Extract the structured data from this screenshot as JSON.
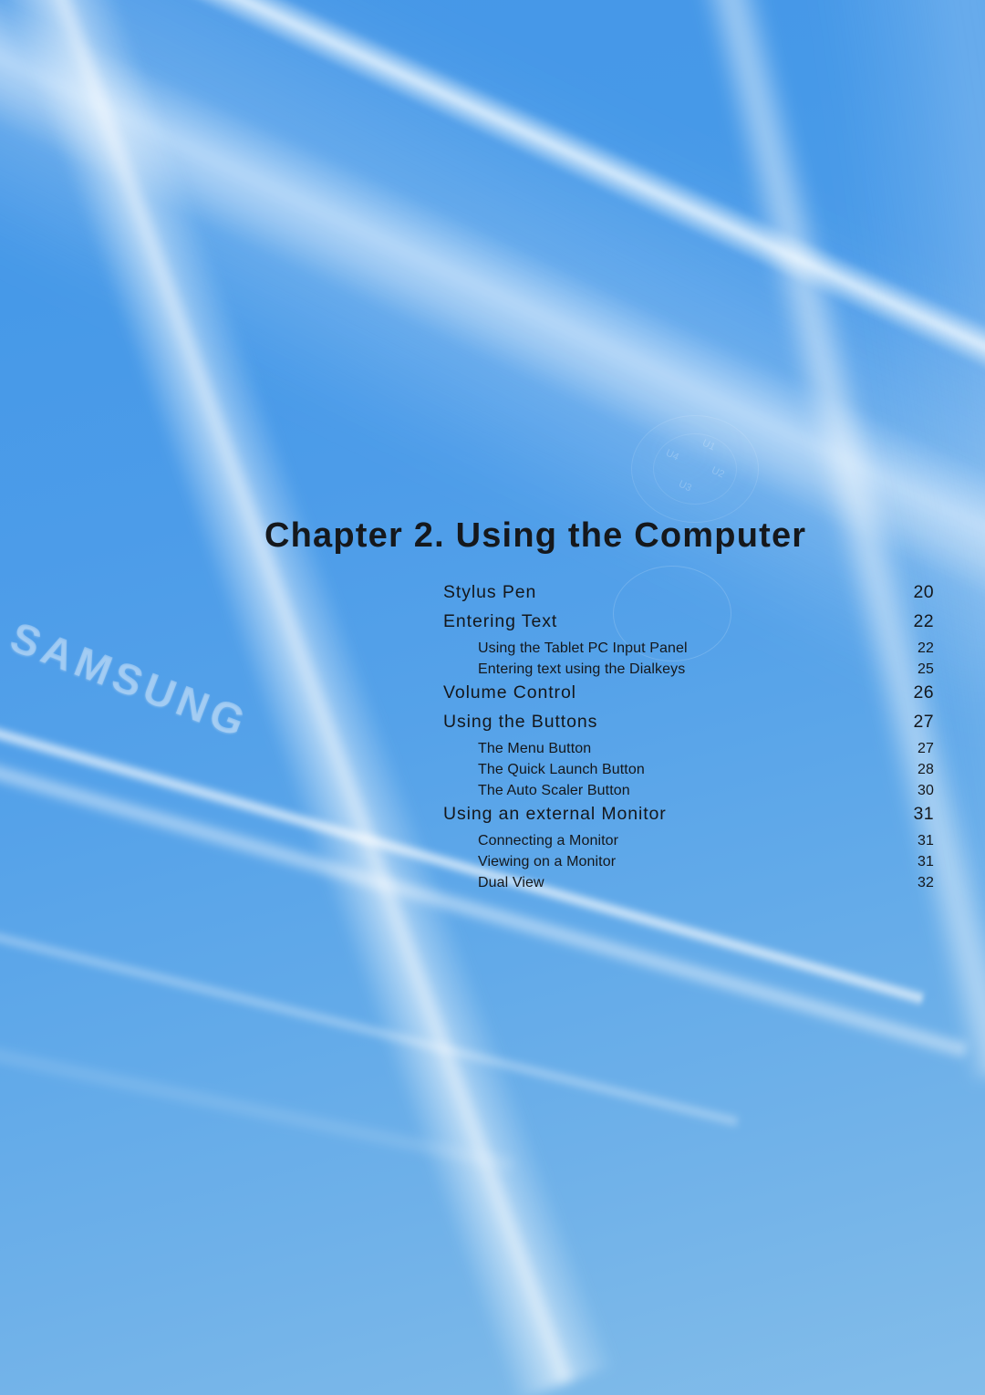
{
  "document": {
    "chapter_title": "Chapter 2.  Using the Computer",
    "brand_watermark": "SAMSUNG"
  },
  "device_watermark": {
    "dial_labels": [
      "U1",
      "U2",
      "U3",
      "U4"
    ]
  },
  "colors": {
    "background_top": "#4697e7",
    "background_bottom": "#83bdea",
    "text": "#14171b",
    "watermark": "rgba(255,255,255,0.30)"
  },
  "toc": {
    "entries": [
      {
        "label": "Stylus Pen",
        "page": "20",
        "level": 1
      },
      {
        "label": "Entering Text",
        "page": "22",
        "level": 1
      },
      {
        "label": "Using the Tablet PC Input Panel",
        "page": "22",
        "level": 2
      },
      {
        "label": "Entering text using the Dialkeys",
        "page": "25",
        "level": 2
      },
      {
        "label": "Volume Control",
        "page": "26",
        "level": 1
      },
      {
        "label": "Using the Buttons",
        "page": "27",
        "level": 1
      },
      {
        "label": "The Menu Button",
        "page": "27",
        "level": 2
      },
      {
        "label": "The Quick Launch Button",
        "page": "28",
        "level": 2
      },
      {
        "label": "The Auto Scaler Button",
        "page": "30",
        "level": 2
      },
      {
        "label": "Using an external Monitor",
        "page": "31",
        "level": 1
      },
      {
        "label": "Connecting a Monitor",
        "page": "31",
        "level": 2
      },
      {
        "label": "Viewing on a Monitor",
        "page": "31",
        "level": 2
      },
      {
        "label": "Dual View",
        "page": "32",
        "level": 2
      }
    ]
  }
}
